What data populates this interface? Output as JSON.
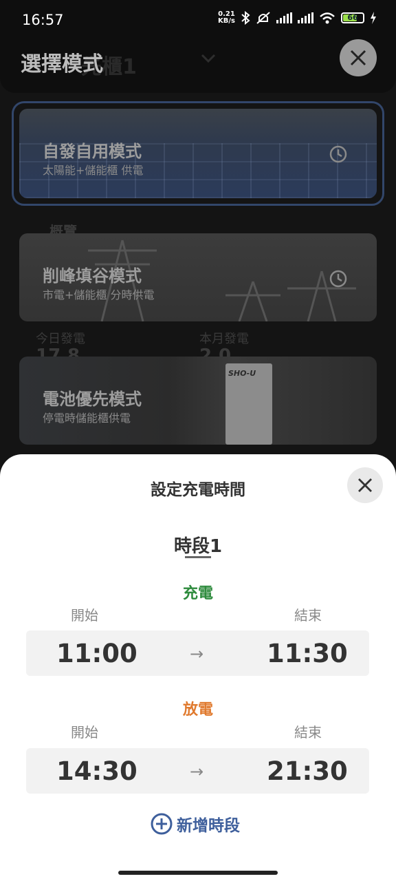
{
  "status_bar": {
    "time": "16:57",
    "net_speed_value": "0.21",
    "net_speed_unit": "KB/s",
    "battery_level": "66"
  },
  "background": {
    "header_ghost": "先櫃1",
    "mode_title": "選擇模式",
    "overview_label": "概覽",
    "stat_today": "今日發電",
    "stat_month": "本月發電",
    "stat_today_value": "17.8",
    "stat_month_value": "2.0",
    "cards": [
      {
        "title": "自發自用模式",
        "subtitle": "太陽能+儲能櫃 供電"
      },
      {
        "title": "削峰填谷模式",
        "subtitle": "市電+儲能櫃 分時供電"
      },
      {
        "title": "電池優先模式",
        "subtitle": "停電時儲能櫃供電",
        "device_logo": "SHO-U"
      }
    ]
  },
  "sheet": {
    "title": "設定充電時間",
    "period_label": "時段1",
    "charge": {
      "label": "充電",
      "color": "#2e8b3d",
      "start_label": "開始",
      "end_label": "結束",
      "start": "11:00",
      "end": "11:30"
    },
    "discharge": {
      "label": "放電",
      "color": "#e07a2e",
      "start_label": "開始",
      "end_label": "結束",
      "start": "14:30",
      "end": "21:30"
    },
    "add_period_label": "新增時段",
    "arrow": "→"
  },
  "colors": {
    "accent_blue": "#3e5f9c",
    "charge_green": "#2e8b3d",
    "discharge_orange": "#e07a2e"
  }
}
